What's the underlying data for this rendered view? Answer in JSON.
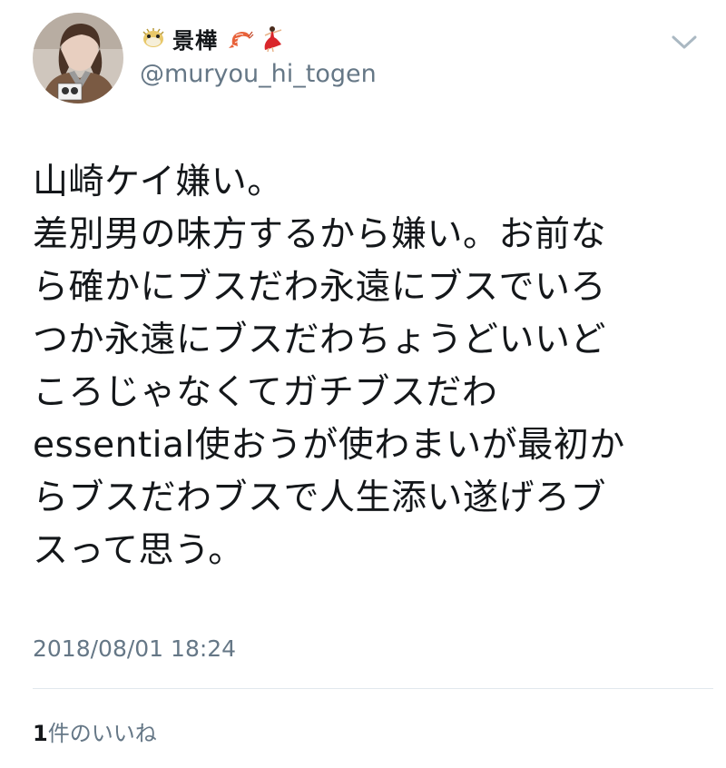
{
  "tweet": {
    "display_name": "景樺",
    "handle": "@muryou_hi_togen",
    "name_emojis": [
      "pufferfish-icon",
      "shrimp-icon",
      "dancer-icon"
    ],
    "text_lines": [
      "山崎ケイ嫌い。",
      "差別男の味方するから嫌い。お前な",
      "ら確かにブスだわ永遠にブスでいろ",
      "つか永遠にブスだわちょうどいいど",
      "ころじゃなくてガチブスだわ",
      "essential使おうが使わまいが最初か",
      "らブスだわブスで人生添い遂げろブ",
      "スって思う。"
    ],
    "timestamp": "2018/08/01 18:24",
    "likes_count": "1",
    "likes_label": "件のいいね"
  },
  "colors": {
    "primary_text": "#14171a",
    "secondary_text": "#657786",
    "divider": "#e1e8ed"
  }
}
